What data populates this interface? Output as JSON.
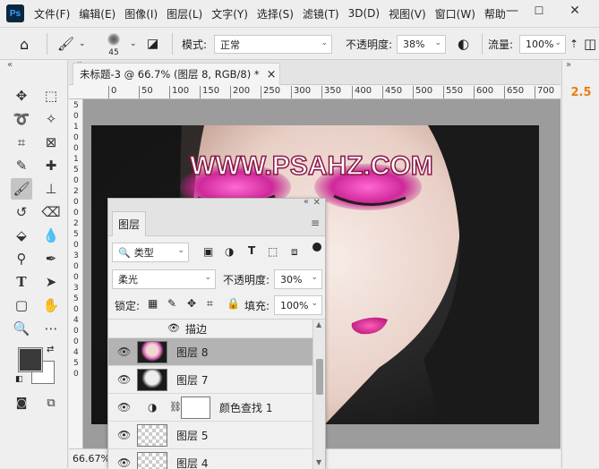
{
  "app": {
    "logo": "Ps"
  },
  "menu": [
    "文件(F)",
    "编辑(E)",
    "图像(I)",
    "图层(L)",
    "文字(Y)",
    "选择(S)",
    "滤镜(T)",
    "3D(D)",
    "视图(V)",
    "窗口(W)",
    "帮助"
  ],
  "options": {
    "brush_size": "45",
    "mode_label": "模式:",
    "mode_value": "正常",
    "opacity_label": "不透明度:",
    "opacity_value": "38%",
    "flow_label": "流量:",
    "flow_value": "100%"
  },
  "document": {
    "tab_title": "未标题-3 @ 66.7% (图层 8, RGB/8) *",
    "close": "×",
    "zoom": "66.67%",
    "watermark": "WWW.PSAHZ.COM"
  },
  "ruler": {
    "h_ticks": [
      "0",
      "50",
      "100",
      "150",
      "200",
      "250",
      "300",
      "350",
      "400",
      "450",
      "500",
      "550",
      "600",
      "650",
      "700",
      "750"
    ],
    "v_ticks": [
      "5",
      "0",
      "1",
      "0",
      "0",
      "1",
      "5",
      "0",
      "2",
      "0",
      "0",
      "2",
      "5",
      "0",
      "3",
      "0",
      "0",
      "3",
      "5",
      "0",
      "4",
      "0",
      "0",
      "4",
      "5",
      "0"
    ]
  },
  "right_panel": {
    "value": "2.5"
  },
  "layers_panel": {
    "tab": "图层",
    "filter_kind": "类型",
    "blend_mode": "柔光",
    "opacity_label": "不透明度:",
    "opacity_value": "30%",
    "lock_label": "锁定:",
    "fill_label": "填充:",
    "fill_value": "100%",
    "effect_row": "描边",
    "layers": [
      {
        "name": "图层 8",
        "selected": true
      },
      {
        "name": "图层 7",
        "selected": false
      },
      {
        "name": "颜色查找 1",
        "selected": false
      },
      {
        "name": "图层 5",
        "selected": false
      },
      {
        "name": "图层 4",
        "selected": false
      }
    ]
  }
}
